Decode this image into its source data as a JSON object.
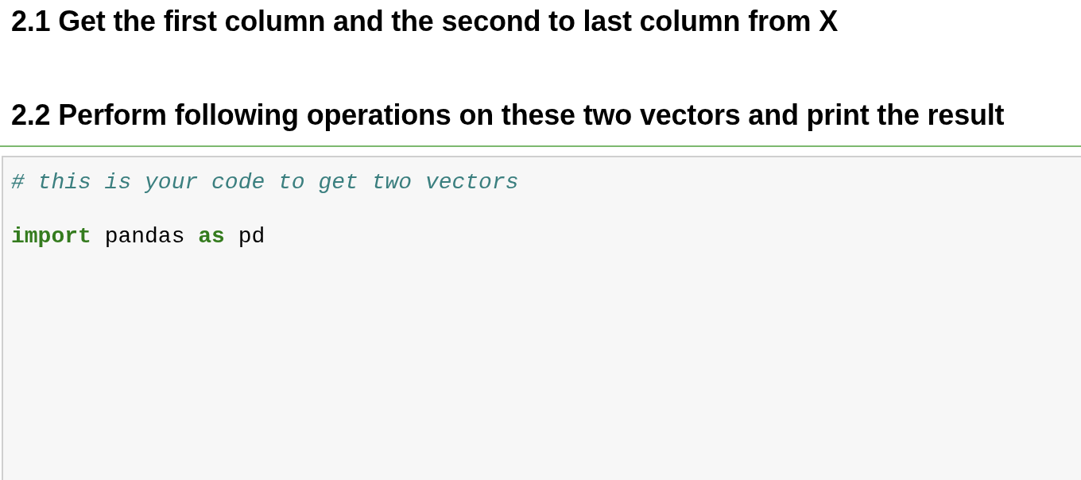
{
  "markdown_cells": [
    {
      "heading": "2.1 Get the first column and the second to last column from X"
    },
    {
      "heading": "2.2 Perform following operations on these two vectors and print the result"
    }
  ],
  "code_cell": {
    "selected": true,
    "lines": [
      {
        "kind": "code",
        "tokens": [
          {
            "kind": "comment",
            "text": "# this is your code to get two vectors"
          }
        ]
      },
      {
        "kind": "blank"
      },
      {
        "kind": "code",
        "tokens": [
          {
            "kind": "keyword",
            "text": "import"
          },
          {
            "kind": "plain",
            "text": " pandas "
          },
          {
            "kind": "keyword",
            "text": "as"
          },
          {
            "kind": "plain",
            "text": " pd"
          }
        ]
      }
    ]
  }
}
